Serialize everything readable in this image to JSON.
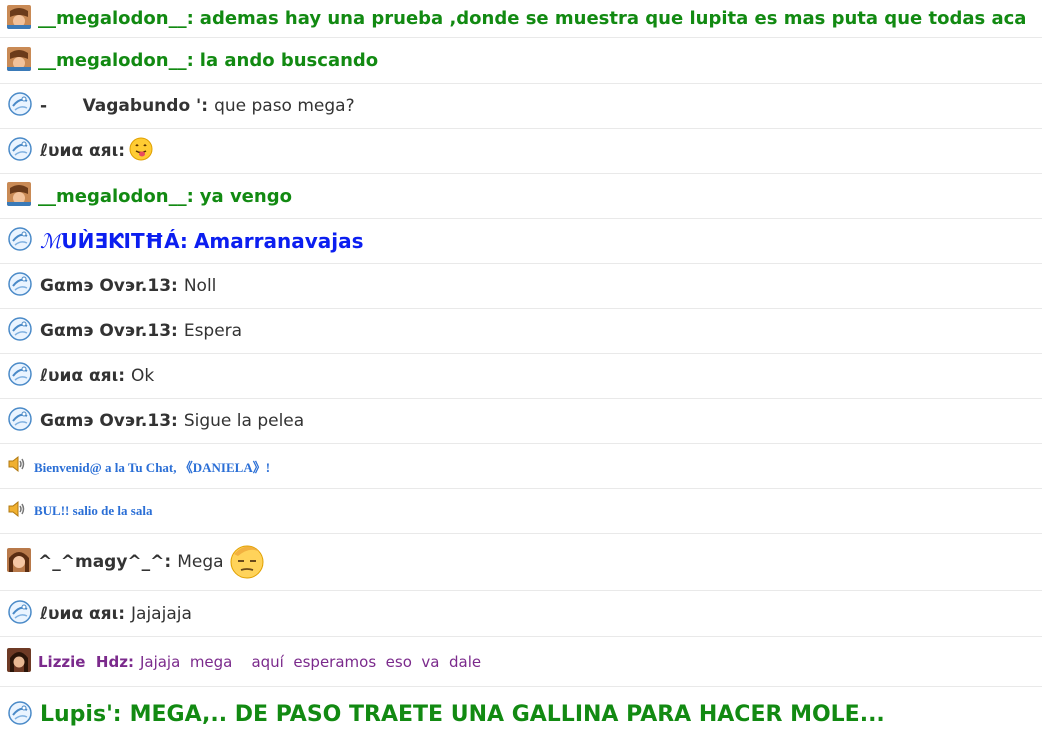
{
  "messages": [
    {
      "nick": "__megalodon__:",
      "text": "ademas hay una prueba ,donde se muestra que lupita es mas puta que todas aca",
      "avatar_icon": "megalodon-avatar-icon"
    },
    {
      "nick": "__megalodon__:",
      "text": "la ando buscando",
      "avatar_icon": "megalodon-avatar-icon"
    },
    {
      "nick": "-      Vagabundo ':",
      "text": "que paso mega?",
      "avatar_icon": "globe-avatar-icon"
    },
    {
      "nick": "ℓυиα αяι:",
      "text": "",
      "avatar_icon": "globe-avatar-icon",
      "emoji": "tongue-emoji-icon"
    },
    {
      "nick": "__megalodon__:",
      "text": "ya vengo",
      "avatar_icon": "megalodon-avatar-icon"
    },
    {
      "nick_fancy": "ℳ",
      "nick": "UЍƎƘITĦÁ:",
      "text": "Amarranavajas",
      "avatar_icon": "globe-avatar-icon"
    },
    {
      "nick": "Gαmэ Ovэr.13:",
      "text": "Noll",
      "avatar_icon": "globe-avatar-icon"
    },
    {
      "nick": "Gαmэ Ovэr.13:",
      "text": "Espera",
      "avatar_icon": "globe-avatar-icon"
    },
    {
      "nick": "ℓυиα αяι:",
      "text": "Ok",
      "avatar_icon": "globe-avatar-icon"
    },
    {
      "nick": "Gαmэ Ovэr.13:",
      "text": "Sigue la pelea",
      "avatar_icon": "globe-avatar-icon"
    },
    {
      "system": "Bienvenid@ a la Tu Chat, 《DANIELA》!",
      "avatar_icon": "speaker-icon"
    },
    {
      "system": "BUL!! salio de la sala",
      "avatar_icon": "speaker-icon"
    },
    {
      "nick": "^_^magy^_^:",
      "text": "Mega",
      "avatar_icon": "magy-avatar-icon",
      "emoji": "sleepy-emoji-icon"
    },
    {
      "nick": "ℓυиα αяι:",
      "text": "Jajajaja",
      "avatar_icon": "globe-avatar-icon"
    },
    {
      "nick": "Lizzie  Hdz:",
      "text": "Jajaja  mega    aquí  esperamos  eso  va  dale",
      "avatar_icon": "lizzie-avatar-icon"
    },
    {
      "nick": "Lupis':",
      "text": "MEGA,.. DE PASO TRAETE UNA GALLINA PARA HACER MOLE...",
      "avatar_icon": "globe-avatar-icon"
    }
  ],
  "colors": {
    "green": "#128a12",
    "blue": "#0b1ef0",
    "dark": "#333333",
    "system": "#2b6fd6",
    "purple": "#7b2a8c",
    "border": "#e9e9e9"
  }
}
